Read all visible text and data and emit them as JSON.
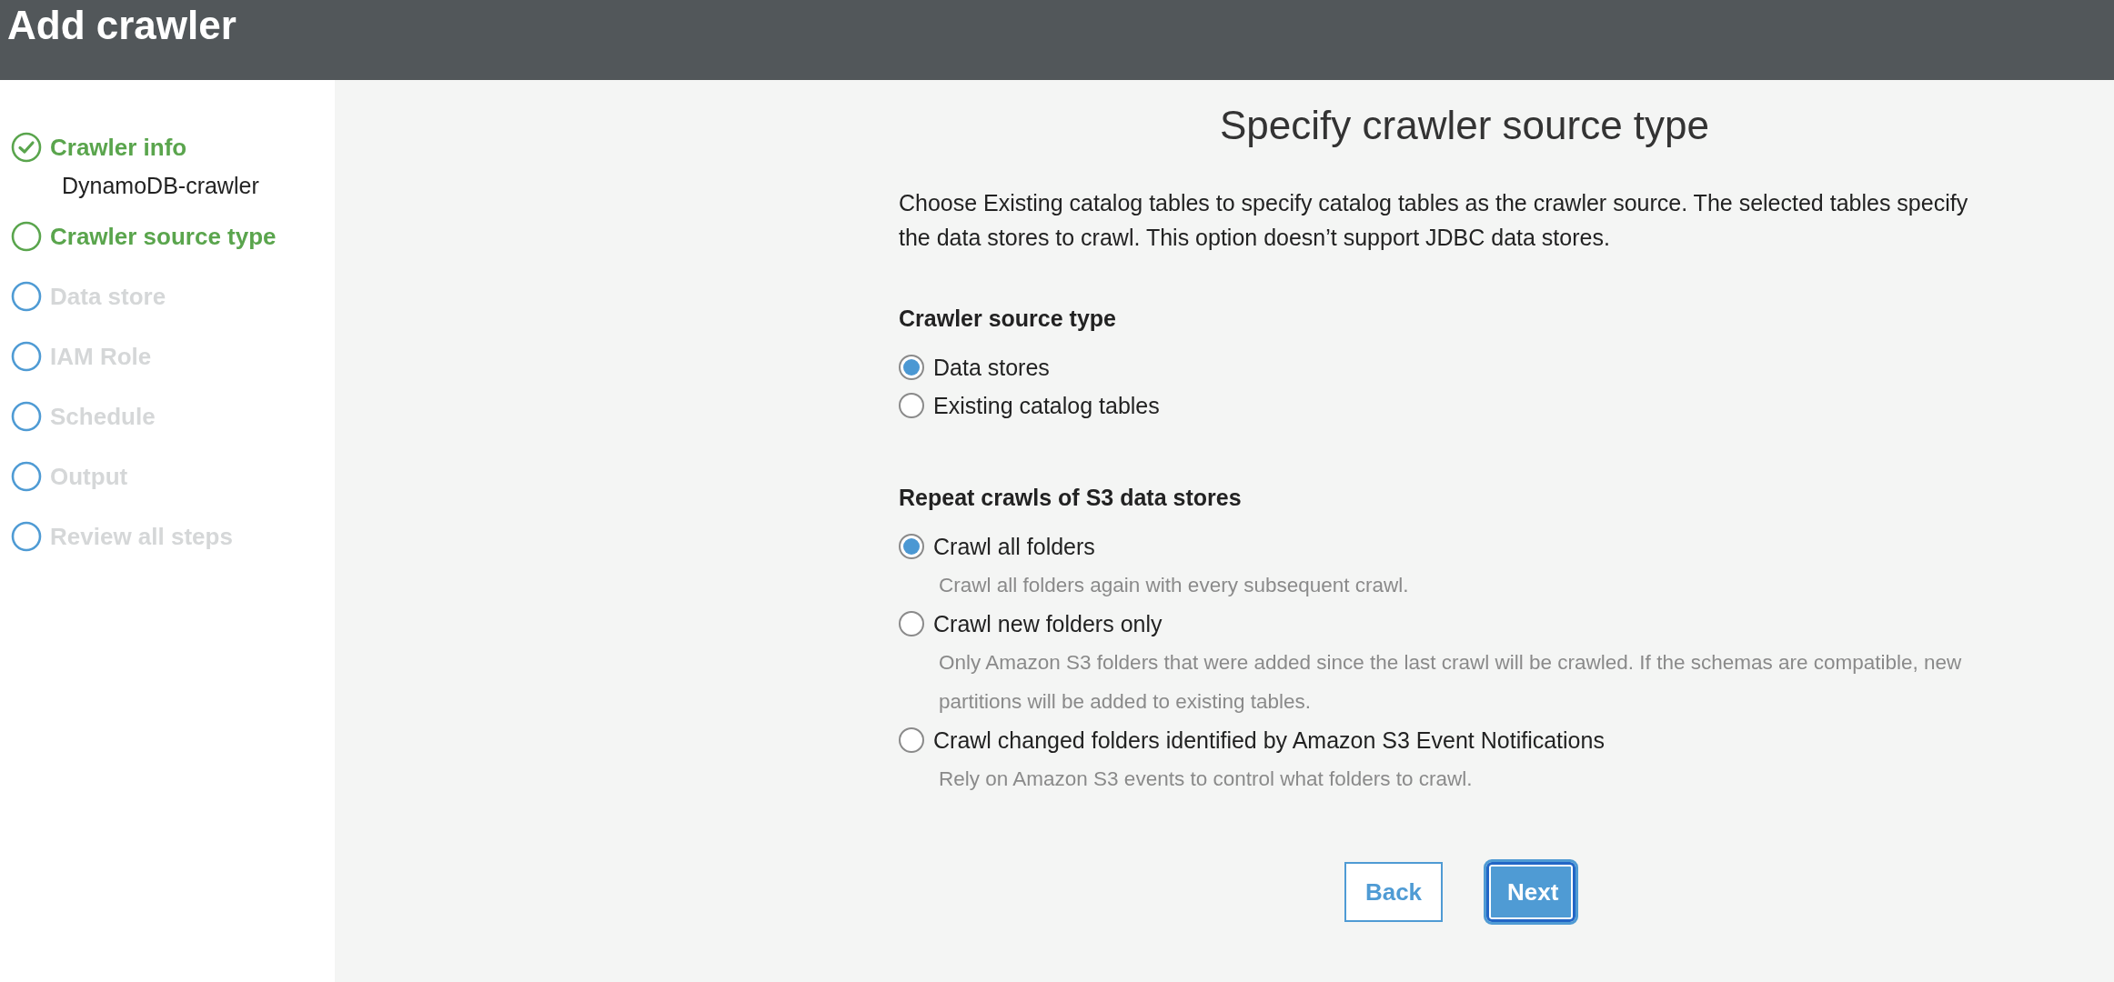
{
  "header": {
    "title": "Add crawler"
  },
  "steps": [
    {
      "label": "Crawler info",
      "completed": true,
      "reached": true,
      "detail": "DynamoDB-crawler"
    },
    {
      "label": "Crawler source type",
      "completed": false,
      "reached": true
    },
    {
      "label": "Data store",
      "completed": false,
      "reached": false
    },
    {
      "label": "IAM Role",
      "completed": false,
      "reached": false
    },
    {
      "label": "Schedule",
      "completed": false,
      "reached": false
    },
    {
      "label": "Output",
      "completed": false,
      "reached": false
    },
    {
      "label": "Review all steps",
      "completed": false,
      "reached": false
    }
  ],
  "page": {
    "heading": "Specify crawler source type",
    "intro": "Choose Existing catalog tables to specify catalog tables as the crawler source. The selected tables specify the data stores to crawl. This option doesn’t support JDBC data stores."
  },
  "groups": [
    {
      "title": "Crawler source type",
      "options": [
        {
          "label": "Data stores",
          "selected": true
        },
        {
          "label": "Existing catalog tables",
          "selected": false
        }
      ]
    },
    {
      "title": "Repeat crawls of S3 data stores",
      "options": [
        {
          "label": "Crawl all folders",
          "selected": true,
          "description": "Crawl all folders again with every subsequent crawl."
        },
        {
          "label": "Crawl new folders only",
          "selected": false,
          "description": "Only Amazon S3 folders that were added since the last crawl will be crawled. If the schemas are compatible, new partitions will be added to existing tables."
        },
        {
          "label": "Crawl changed folders identified by Amazon S3 Event Notifications",
          "selected": false,
          "description": "Rely on Amazon S3 events to control what folders to crawl."
        }
      ]
    }
  ],
  "buttons": [
    {
      "label": "Back",
      "kind": "secondary"
    },
    {
      "label": "Next",
      "kind": "primary"
    }
  ]
}
